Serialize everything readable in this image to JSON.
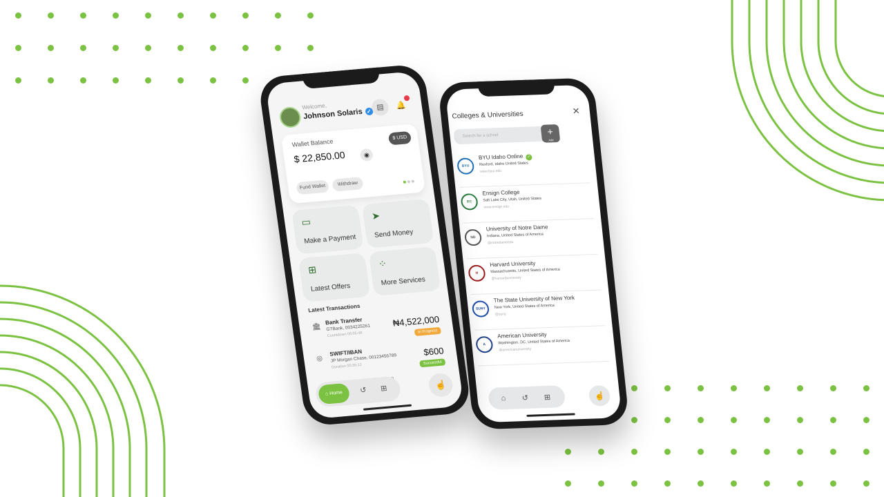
{
  "colors": {
    "accent": "#7cc242",
    "dark": "#1b1b1b",
    "verified": "#2e8ee8",
    "alert": "#e83a4a",
    "pending": "#f0a93a"
  },
  "phone1": {
    "welcome": "Welcome,",
    "user_name": "Johnson Solaris",
    "wallet": {
      "title": "Wallet Balance",
      "amount": "$ 22,850.00",
      "currency": "$ USD",
      "fund_label": "Fund Wallet",
      "withdraw_label": "Withdraw"
    },
    "tiles": [
      {
        "label": "Make a Payment",
        "icon": "wallet-icon"
      },
      {
        "label": "Send Money",
        "icon": "send-icon"
      },
      {
        "label": "Latest Offers",
        "icon": "offers-icon"
      },
      {
        "label": "More Services",
        "icon": "services-icon"
      }
    ],
    "transactions_title": "Latest Transactions",
    "transactions": [
      {
        "title": "Bank Transfer",
        "detail": "GTBank, 0034225261",
        "sub": "Countdown 00:05:48",
        "amount": "₦4,522,000",
        "status": "In Progress"
      },
      {
        "title": "SWIFT/IBAN",
        "detail": "JP Morgan Chase, 00123456789",
        "sub": "Duration 00:35:12",
        "amount": "$600",
        "status": "Successful"
      }
    ],
    "see_more": "See More",
    "nav_home": "Home"
  },
  "phone2": {
    "title": "Colleges & Universities",
    "search_placeholder": "Search for a school",
    "add_label": "Add",
    "universities": [
      {
        "name": "BYU Idaho Online",
        "location": "Rexford, Idaho United States",
        "web": "www.byui.edu",
        "logo": "BYU",
        "verified": true
      },
      {
        "name": "Ensign College",
        "location": "Salt Lake City, Utah, United States",
        "web": "www.ensign.edu",
        "logo": "EC",
        "verified": false
      },
      {
        "name": "University of Notre Dame",
        "location": "Indiana, United States of America",
        "web": "@notredameedu",
        "logo": "ND",
        "verified": false
      },
      {
        "name": "Harvard University",
        "location": "Massachusetts, United States of America",
        "web": "@harvarduniversity",
        "logo": "H",
        "verified": false
      },
      {
        "name": "The State University of New York",
        "location": "New York, United States of America",
        "web": "@suny",
        "logo": "SUNY",
        "verified": false
      },
      {
        "name": "American University",
        "location": "Washington, DC, United States of America",
        "web": "@americanuniversity",
        "logo": "A",
        "verified": false
      }
    ]
  }
}
